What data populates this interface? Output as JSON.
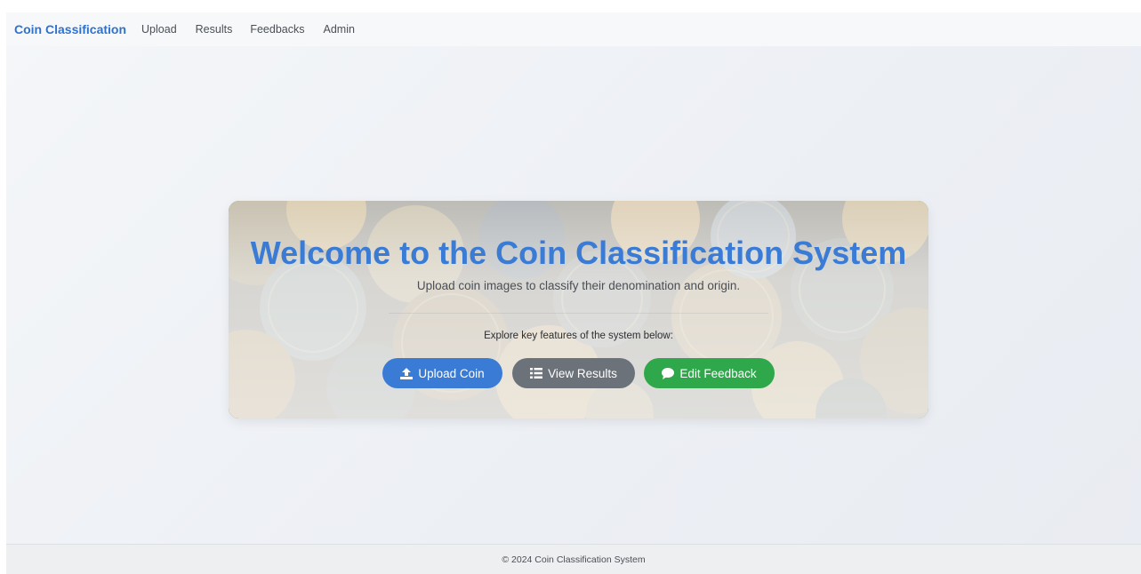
{
  "navbar": {
    "brand": "Coin Classification",
    "links": [
      "Upload",
      "Results",
      "Feedbacks",
      "Admin"
    ]
  },
  "hero": {
    "title": "Welcome to the Coin Classification System",
    "subtitle": "Upload coin images to classify their denomination and origin.",
    "explore_text": "Explore key features of the system below:",
    "buttons": [
      {
        "label": "Upload Coin",
        "icon": "upload-icon",
        "color": "#3a7bd5"
      },
      {
        "label": "View Results",
        "icon": "list-icon",
        "color": "#6b727a"
      },
      {
        "label": "Edit Feedback",
        "icon": "comment-icon",
        "color": "#2ea84a"
      }
    ]
  },
  "footer": {
    "text": "© 2024 Coin Classification System"
  },
  "colors": {
    "brand": "#2f72cc",
    "title": "#3a7bd5"
  }
}
